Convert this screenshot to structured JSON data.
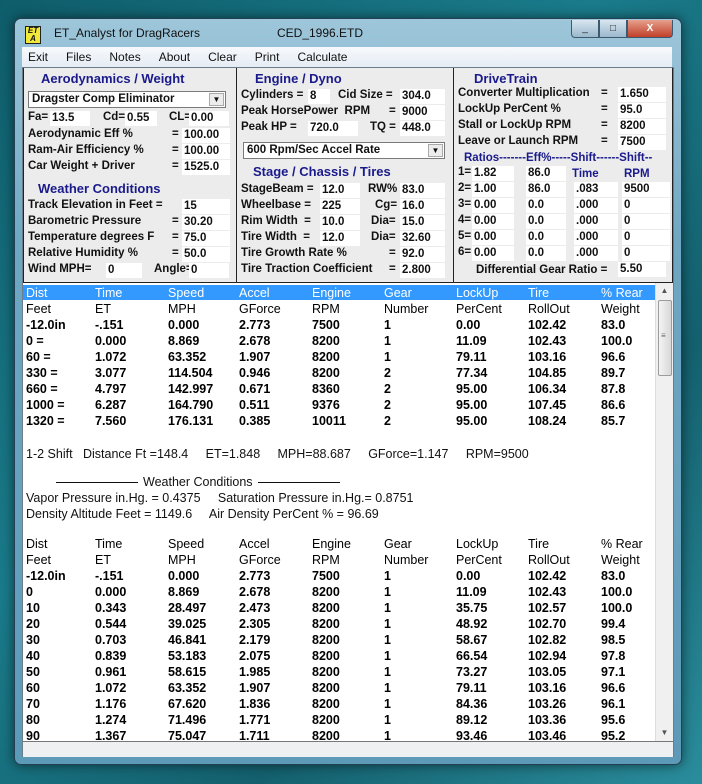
{
  "window": {
    "app_icon_text": "ET A",
    "title": "ET_Analyst for DragRacers",
    "file": "CED_1996.ETD",
    "buttons": {
      "minimize": "_",
      "maximize": "□",
      "close": "X"
    }
  },
  "menu": [
    "Exit",
    "Files",
    "Notes",
    "About",
    "Clear",
    "Print",
    "Calculate"
  ],
  "aero": {
    "title": "Aerodynamics / Weight",
    "class_select": "Dragster Comp Eliminator",
    "fa_label": "Fa=",
    "fa": "13.5",
    "cd_label": "Cd=",
    "cd": "0.55",
    "cl_label": "CL=",
    "cl": "0.00",
    "aero_eff_label": "Aerodynamic Eff %",
    "aero_eff": "100.00",
    "ram_air_label": "Ram-Air Efficiency %",
    "ram_air": "100.00",
    "weight_label": "Car Weight + Driver",
    "weight": "1525.0",
    "eq": "="
  },
  "weather": {
    "title": "Weather Conditions",
    "elev_label": "Track Elevation in Feet =",
    "elev": "15",
    "baro_label": "Barometric Pressure",
    "baro": "30.20",
    "temp_label": "Temperature degrees F",
    "temp": "75.0",
    "hum_label": "Relative Humidity %",
    "hum": "50.0",
    "wind_label": "Wind MPH=",
    "wind": "0",
    "angle_label": "Angle=",
    "angle": "0"
  },
  "engine": {
    "title": "Engine / Dyno",
    "cyl_label": "Cylinders =",
    "cyl": "8",
    "cid_label": "Cid Size =",
    "cid": "304.0",
    "hp_rpm_label": "Peak HorsePower  RPM",
    "hp_rpm": "9000",
    "hp_label": "Peak HP =",
    "hp": "720.0",
    "tq_label": "TQ =",
    "tq": "448.0",
    "accel_select": "600 Rpm/Sec Accel Rate"
  },
  "chassis": {
    "title": "Stage / Chassis / Tires",
    "stage_label": "StageBeam =",
    "stage": "12.0",
    "rw_label": "RW%",
    "rw": "83.0",
    "wb_label": "Wheelbase =",
    "wb": "225",
    "cg_label": "Cg=",
    "cg": "16.0",
    "rim_label": "Rim Width  =",
    "rim": "10.0",
    "rim_dia_label": "Dia=",
    "rim_dia": "15.0",
    "tire_label": "Tire Width  =",
    "tire": "12.0",
    "tire_dia_label": "Dia=",
    "tire_dia": "32.60",
    "growth_label": "Tire Growth Rate %",
    "growth": "92.0",
    "traction_label": "Tire Traction Coefficient",
    "traction": "2.800"
  },
  "drivetrain": {
    "title": "DriveTrain",
    "conv_label": "Converter Multiplication",
    "conv": "1.650",
    "lockup_label": "LockUp PerCent %",
    "lockup": "95.0",
    "stall_label": "Stall or LockUp RPM",
    "stall": "8200",
    "launch_label": "Leave or Launch RPM",
    "launch": "7500",
    "ratios_header": "Ratios-------Eff%-----Shift------Shift--",
    "time_label": "Time",
    "rpm_label": "RPM",
    "gears": [
      {
        "label": "1=",
        "ratio": "1.82",
        "eff": "86.0",
        "time": "",
        "rpm": ""
      },
      {
        "label": "2=",
        "ratio": "1.00",
        "eff": "86.0",
        "time": ".083",
        "rpm": "9500"
      },
      {
        "label": "3=",
        "ratio": "0.00",
        "eff": "0.0",
        "time": ".000",
        "rpm": "0"
      },
      {
        "label": "4=",
        "ratio": "0.00",
        "eff": "0.0",
        "time": ".000",
        "rpm": "0"
      },
      {
        "label": "5=",
        "ratio": "0.00",
        "eff": "0.0",
        "time": ".000",
        "rpm": "0"
      },
      {
        "label": "6=",
        "ratio": "0.00",
        "eff": "0.0",
        "time": ".000",
        "rpm": "0"
      }
    ],
    "diff_label": "Differential Gear Ratio =",
    "diff": "5.50"
  },
  "output": {
    "headers1": [
      "Dist",
      "Time",
      "Speed",
      "Accel",
      "Engine",
      "Gear",
      "LockUp",
      "Tire",
      "% Rear"
    ],
    "headers2": [
      "Feet",
      "ET",
      "MPH",
      "GForce",
      "RPM",
      "Number",
      "PerCent",
      "RollOut",
      "Weight"
    ],
    "summary_rows": [
      [
        "-12.0in",
        "-.151",
        "0.000",
        "2.773",
        "7500",
        "1",
        "0.00",
        "102.42",
        "83.0"
      ],
      [
        " 0 =",
        "0.000",
        "8.869",
        "2.678",
        "8200",
        "1",
        "11.09",
        "102.43",
        "100.0"
      ],
      [
        " 60 =",
        "1.072",
        "63.352",
        "1.907",
        "8200",
        "1",
        "79.11",
        "103.16",
        "96.6"
      ],
      [
        " 330 =",
        "3.077",
        "114.504",
        "0.946",
        "8200",
        "2",
        "77.34",
        "104.85",
        "89.7"
      ],
      [
        " 660 =",
        "4.797",
        "142.997",
        "0.671",
        "8360",
        "2",
        "95.00",
        "106.34",
        "87.8"
      ],
      [
        "1000 =",
        "6.287",
        "164.790",
        "0.511",
        "9376",
        "2",
        "95.00",
        "107.45",
        "86.6"
      ],
      [
        "1320 =",
        "7.560",
        "176.131",
        "0.385",
        "10011",
        "2",
        "95.00",
        "108.24",
        "85.7"
      ]
    ],
    "shift_line": "1-2 Shift   Distance Ft =148.4     ET=1.848     MPH=88.687     GForce=1.147     RPM=9500",
    "weather_title": "Weather Conditions",
    "vapor_line": "Vapor Pressure in.Hg. = 0.4375     Saturation Pressure in.Hg.= 0.8751",
    "density_line": "Density Altitude Feet = 1149.6     Air Density PerCent % = 96.69",
    "detail_rows": [
      [
        "-12.0in",
        "-.151",
        "0.000",
        "2.773",
        "7500",
        "1",
        "0.00",
        "102.42",
        "83.0"
      ],
      [
        " 0",
        "0.000",
        "8.869",
        "2.678",
        "8200",
        "1",
        "11.09",
        "102.43",
        "100.0"
      ],
      [
        "10",
        "0.343",
        "28.497",
        "2.473",
        "8200",
        "1",
        "35.75",
        "102.57",
        "100.0"
      ],
      [
        "20",
        "0.544",
        "39.025",
        "2.305",
        "8200",
        "1",
        "48.92",
        "102.70",
        "99.4"
      ],
      [
        "30",
        "0.703",
        "46.841",
        "2.179",
        "8200",
        "1",
        "58.67",
        "102.82",
        "98.5"
      ],
      [
        "40",
        "0.839",
        "53.183",
        "2.075",
        "8200",
        "1",
        "66.54",
        "102.94",
        "97.8"
      ],
      [
        "50",
        "0.961",
        "58.615",
        "1.985",
        "8200",
        "1",
        "73.27",
        "103.05",
        "97.1"
      ],
      [
        "60",
        "1.072",
        "63.352",
        "1.907",
        "8200",
        "1",
        "79.11",
        "103.16",
        "96.6"
      ],
      [
        "70",
        "1.176",
        "67.620",
        "1.836",
        "8200",
        "1",
        "84.36",
        "103.26",
        "96.1"
      ],
      [
        "80",
        "1.274",
        "71.496",
        "1.771",
        "8200",
        "1",
        "89.12",
        "103.36",
        "95.6"
      ],
      [
        "90",
        "1.367",
        "75.047",
        "1.711",
        "8200",
        "1",
        "93.46",
        "103.46",
        "95.2"
      ]
    ]
  },
  "colors": {
    "accent_header": "#3399ff",
    "section_title": "#1a1a8c"
  }
}
